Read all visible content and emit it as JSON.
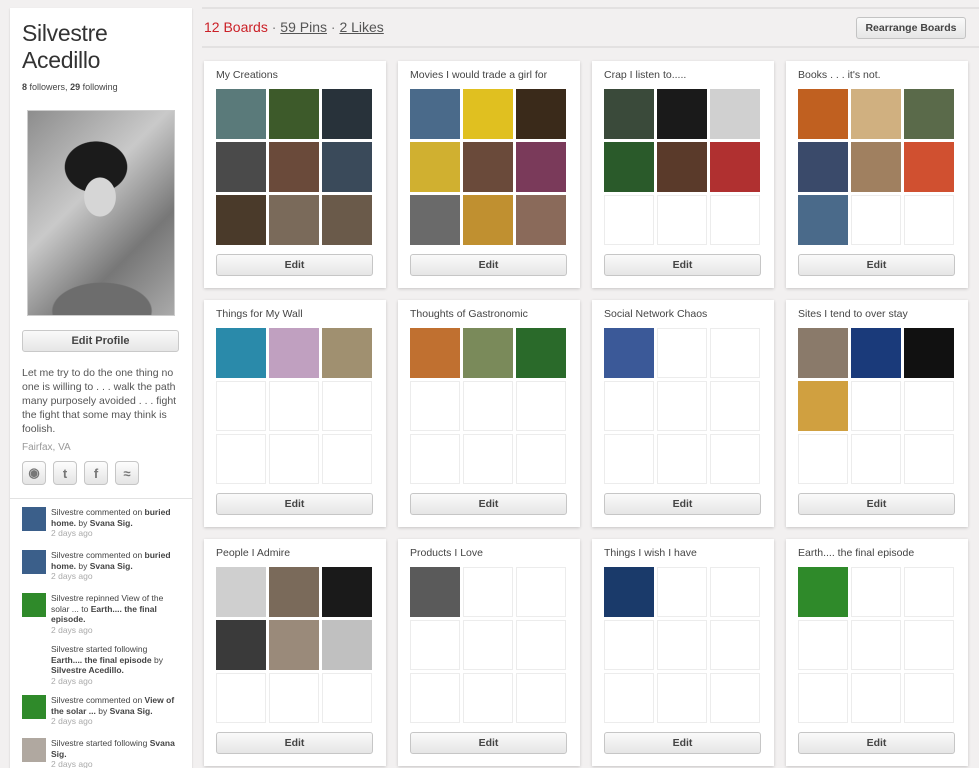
{
  "profile": {
    "first_name": "Silvestre",
    "last_name": "Acedillo",
    "followers_count": "8",
    "followers_label": "followers,",
    "following_count": "29",
    "following_label": "following",
    "edit_profile_label": "Edit Profile",
    "bio": "Let me try to do the one thing no one is willing to . . . walk the path many purposely avoided . . . fight the fight that some may think is foolish.",
    "location": "Fairfax, VA",
    "social_icons": [
      "globe-icon",
      "twitter-icon",
      "facebook-icon",
      "rss-icon"
    ]
  },
  "activity": [
    {
      "text": "Silvestre commented on ",
      "target": "buried home.",
      "by": " by ",
      "user": "Svana Sig.",
      "time": "2 days ago",
      "thumb": "#3b5f8a"
    },
    {
      "text": "Silvestre commented on ",
      "target": "buried home.",
      "by": " by ",
      "user": "Svana Sig.",
      "time": "2 days ago",
      "thumb": "#3b5f8a"
    },
    {
      "text": "Silvestre repinned View of the solar ... to ",
      "target": "Earth.... the final episode.",
      "by": "",
      "user": "",
      "time": "2 days ago",
      "thumb": "#2f8a2a"
    },
    {
      "text": "Silvestre started following ",
      "target": "Earth.... the final episode",
      "by": " by ",
      "user": "Silvestre Acedillo.",
      "time": "2 days ago",
      "thumb": ""
    },
    {
      "text": "Silvestre commented on ",
      "target": "View of the solar ...",
      "by": " by ",
      "user": "Svana Sig.",
      "time": "2 days ago",
      "thumb": "#2f8a2a"
    },
    {
      "text": "Silvestre started following ",
      "target": "Svana Sig.",
      "by": "",
      "user": "",
      "time": "2 days ago",
      "thumb": "#b0a8a0"
    }
  ],
  "header": {
    "boards_label": "12 Boards",
    "separator": "·",
    "pins_label": "59 Pins",
    "likes_label": "2 Likes",
    "rearrange_label": "Rearrange Boards"
  },
  "edit_label": "Edit",
  "boards": [
    {
      "title": "My Creations",
      "thumbs": [
        "#5a7a7a",
        "#3d5a2a",
        "#28323a",
        "#4a4a4a",
        "#6a4a3a",
        "#3a4a5a",
        "#4a3a2a",
        "#7a6a5a",
        "#6a5a4a"
      ]
    },
    {
      "title": "Movies I would trade a girl for",
      "thumbs": [
        "#4a6a8a",
        "#e0c020",
        "#3a2a1a",
        "#d0b030",
        "#6a4a3a",
        "#7a3a5a",
        "#6a6a6a",
        "#c09030",
        "#8a6a5a"
      ]
    },
    {
      "title": "Crap I listen to.....",
      "thumbs": [
        "#3a4a3a",
        "#1a1a1a",
        "#d0d0d0",
        "#2a5a2a",
        "#5a3a2a",
        "#b03030",
        "",
        "",
        ""
      ]
    },
    {
      "title": "Books . . . it's not.",
      "thumbs": [
        "#c06020",
        "#d0b080",
        "#5a6a4a",
        "#3a4a6a",
        "#a08060",
        "#d05030",
        "#4a6a8a",
        "",
        ""
      ]
    },
    {
      "title": "Things for My Wall",
      "thumbs": [
        "#2a8aaa",
        "#c0a0c0",
        "#a09070",
        "",
        "",
        "",
        "",
        "",
        ""
      ]
    },
    {
      "title": "Thoughts of Gastronomic",
      "thumbs": [
        "#c07030",
        "#7a8a5a",
        "#2a6a2a",
        "",
        "",
        "",
        "",
        "",
        ""
      ]
    },
    {
      "title": "Social Network Chaos",
      "thumbs": [
        "#3b5998",
        "",
        "",
        "",
        "",
        "",
        "",
        "",
        ""
      ]
    },
    {
      "title": "Sites I tend to over stay",
      "thumbs": [
        "#8a7a6a",
        "#1a3a7a",
        "#111111",
        "#d0a040",
        "",
        "",
        "",
        "",
        ""
      ]
    },
    {
      "title": "People I Admire",
      "thumbs": [
        "#cfcfcf",
        "#7a6a5a",
        "#1a1a1a",
        "#3a3a3a",
        "#9a8a7a",
        "#c0c0c0",
        "",
        "",
        ""
      ]
    },
    {
      "title": "Products I Love",
      "thumbs": [
        "#5a5a5a",
        "",
        "",
        "",
        "",
        "",
        "",
        "",
        ""
      ]
    },
    {
      "title": "Things I wish I have",
      "thumbs": [
        "#1a3a6a",
        "",
        "",
        "",
        "",
        "",
        "",
        "",
        ""
      ]
    },
    {
      "title": "Earth.... the final episode",
      "thumbs": [
        "#2f8a2a",
        "",
        "",
        "",
        "",
        "",
        "",
        "",
        ""
      ]
    }
  ]
}
